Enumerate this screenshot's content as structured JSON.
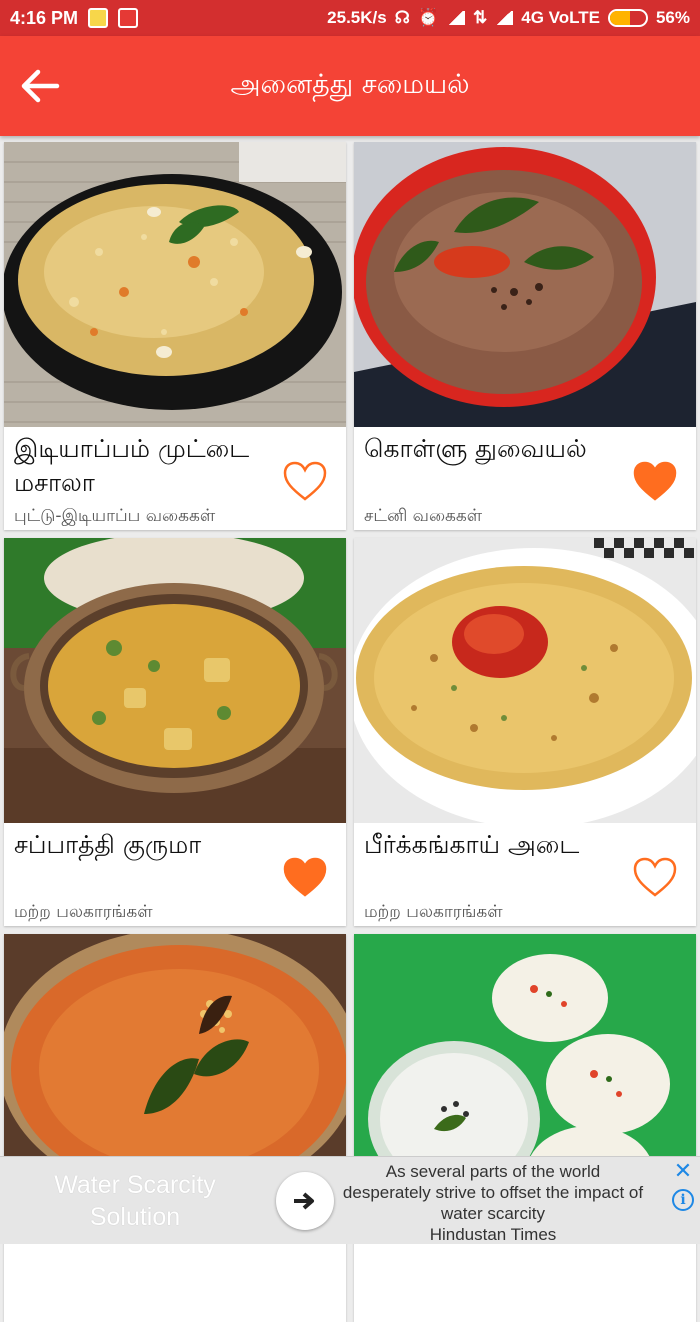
{
  "status_bar": {
    "time": "4:16 PM",
    "speed": "25.5K/s",
    "network": "4G VoLTE",
    "battery": "56%",
    "battery_level": 0.56
  },
  "app_bar": {
    "back_icon": "arrow-left-icon",
    "title": "அனைத்து சமையல்"
  },
  "recipes": [
    {
      "name": "இடியாப்பம் முட்டை மசாலா",
      "category": "புட்டு-இடியாப்ப வகைகள்",
      "favorite": false,
      "dish": "noodles"
    },
    {
      "name": "கொள்ளு துவையல்",
      "category": "சட்னி வகைகள்",
      "favorite": true,
      "dish": "thuvayal"
    },
    {
      "name": "சப்பாத்தி குருமா",
      "category": "மற்ற பலகாரங்கள்",
      "favorite": true,
      "dish": "kurma"
    },
    {
      "name": "பீர்க்கங்காய் அடை",
      "category": "மற்ற பலகாரங்கள்",
      "favorite": false,
      "dish": "adai"
    },
    {
      "name": "",
      "category": "",
      "favorite": false,
      "dish": "sambar"
    },
    {
      "name": "",
      "category": "",
      "favorite": false,
      "dish": "idli"
    }
  ],
  "colors": {
    "status_bar": "#d32f2f",
    "app_bar": "#f44336",
    "heart": "#ff6d1f"
  },
  "ad": {
    "headline": "Water Scarcity Solution",
    "body": "As several parts of the world desperately strive to offset the impact of water scarcity",
    "source": "Hindustan Times",
    "go_icon": "arrow-right-icon",
    "close_icon": "close-icon",
    "info_icon": "info-icon"
  }
}
